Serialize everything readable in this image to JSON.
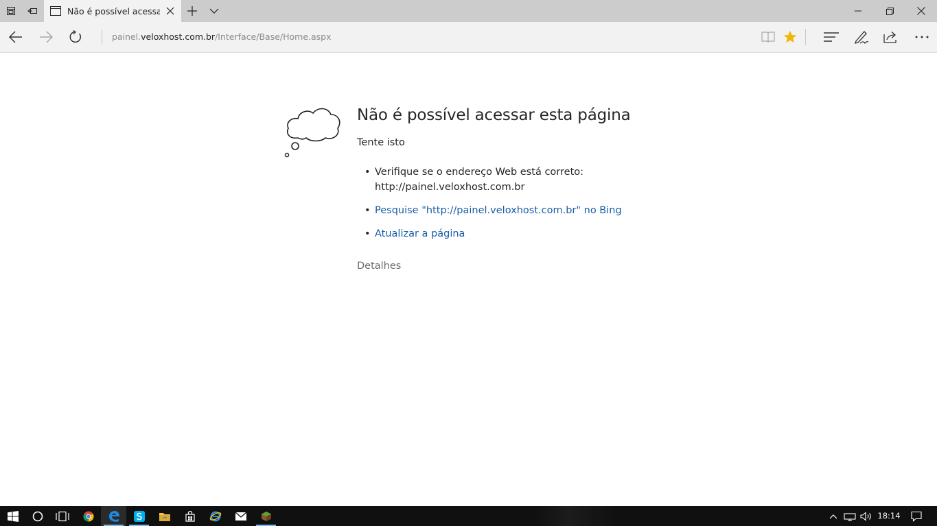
{
  "browser": {
    "tab": {
      "title": "Não é possível acessar esta página"
    },
    "address": {
      "host_muted_prefix": "painel.",
      "host_main": "veloxhost.com.br",
      "path": "/Interface/Base/Home.aspx"
    },
    "icons": {
      "tab_actions": [
        "tabs-aside-icon",
        "restore-tabs-icon"
      ],
      "tab_tools": [
        "new-tab-icon",
        "tab-preview-chevron-icon"
      ],
      "window": [
        "minimize-icon",
        "maximize-icon",
        "close-icon"
      ],
      "nav": [
        "back-icon",
        "forward-icon",
        "refresh-icon"
      ],
      "toolbar": [
        "reading-view-icon",
        "favorite-star-icon",
        "hub-icon",
        "web-note-icon",
        "share-icon",
        "more-icon"
      ]
    },
    "colors": {
      "favorite_star": "#f2b705",
      "link": "#1a5ea8"
    }
  },
  "error_page": {
    "title": "Não é possível acessar esta página",
    "try_this": "Tente isto",
    "suggestions": {
      "check_address_line1": "Verifique se o endereço Web está correto:",
      "check_address_line2": "http://painel.veloxhost.com.br",
      "search_bing": "Pesquise \"http://painel.veloxhost.com.br\" no Bing",
      "refresh": "Atualizar a página"
    },
    "details": "Detalhes"
  },
  "taskbar": {
    "apps": [
      "windows-start-icon",
      "cortana-search-icon",
      "task-view-icon",
      "chrome-icon",
      "edge-icon",
      "skype-icon",
      "file-explorer-icon",
      "store-icon",
      "internet-explorer-icon",
      "mail-icon",
      "minecraft-icon"
    ],
    "tray": [
      "show-hidden-icons-icon",
      "network-icon",
      "volume-icon"
    ],
    "clock": "18:14",
    "notifications": "action-center-icon"
  }
}
